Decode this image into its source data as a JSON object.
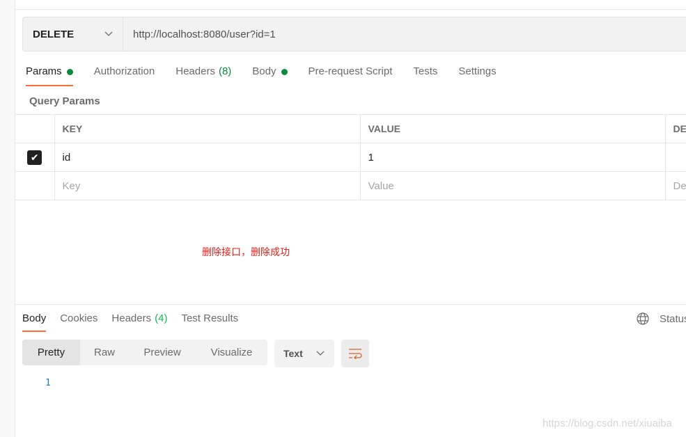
{
  "request": {
    "method": "DELETE",
    "url": "http://localhost:8080/user?id=1"
  },
  "tabs": [
    {
      "label": "Params",
      "dot": true
    },
    {
      "label": "Authorization"
    },
    {
      "label": "Headers",
      "count": "(8)"
    },
    {
      "label": "Body",
      "dot": true
    },
    {
      "label": "Pre-request Script"
    },
    {
      "label": "Tests"
    },
    {
      "label": "Settings"
    }
  ],
  "query_params": {
    "title": "Query Params",
    "headers": {
      "key": "KEY",
      "value": "VALUE",
      "description": "DE"
    },
    "rows": [
      {
        "checked": true,
        "key": "id",
        "value": "1"
      }
    ],
    "placeholders": {
      "key": "Key",
      "value": "Value",
      "description": "De"
    }
  },
  "annotation": "删除接口，删除成功",
  "response": {
    "tabs": [
      {
        "label": "Body"
      },
      {
        "label": "Cookies"
      },
      {
        "label": "Headers",
        "count": "(4)"
      },
      {
        "label": "Test Results"
      }
    ],
    "status_label": "Status",
    "views": [
      "Pretty",
      "Raw",
      "Preview",
      "Visualize"
    ],
    "format": "Text",
    "body_lines": [
      "1"
    ]
  },
  "watermark": "https://blog.csdn.net/xiuaiba",
  "colors": {
    "accent": "#ff6c37",
    "green": "#0a8a3a"
  }
}
